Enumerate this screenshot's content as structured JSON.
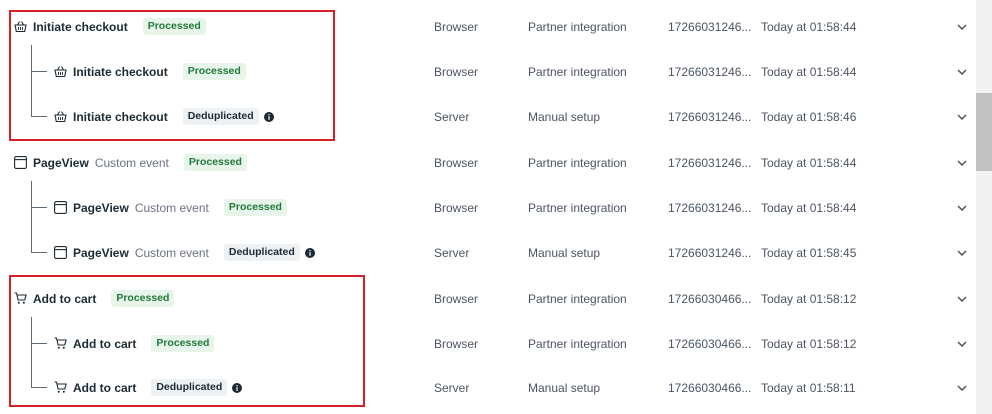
{
  "rows": [
    {
      "icon": "basket-icon",
      "name": "Initiate checkout",
      "custom": "",
      "status": "Processed",
      "source": "Browser",
      "method": "Partner integration",
      "id": "17266031246...",
      "time": "Today at 01:58:44"
    },
    {
      "icon": "basket-icon",
      "name": "Initiate checkout",
      "custom": "",
      "status": "Processed",
      "source": "Browser",
      "method": "Partner integration",
      "id": "17266031246...",
      "time": "Today at 01:58:44"
    },
    {
      "icon": "basket-icon",
      "name": "Initiate checkout",
      "custom": "",
      "status": "Deduplicated",
      "source": "Server",
      "method": "Manual setup",
      "id": "17266031246...",
      "time": "Today at 01:58:46"
    },
    {
      "icon": "browser-window-icon",
      "name": "PageView",
      "custom": "Custom event",
      "status": "Processed",
      "source": "Browser",
      "method": "Partner integration",
      "id": "17266031246...",
      "time": "Today at 01:58:44"
    },
    {
      "icon": "browser-window-icon",
      "name": "PageView",
      "custom": "Custom event",
      "status": "Processed",
      "source": "Browser",
      "method": "Partner integration",
      "id": "17266031246...",
      "time": "Today at 01:58:44"
    },
    {
      "icon": "browser-window-icon",
      "name": "PageView",
      "custom": "Custom event",
      "status": "Deduplicated",
      "source": "Server",
      "method": "Manual setup",
      "id": "17266031246...",
      "time": "Today at 01:58:45"
    },
    {
      "icon": "cart-icon",
      "name": "Add to cart",
      "custom": "",
      "status": "Processed",
      "source": "Browser",
      "method": "Partner integration",
      "id": "17266030466...",
      "time": "Today at 01:58:12"
    },
    {
      "icon": "cart-icon",
      "name": "Add to cart",
      "custom": "",
      "status": "Processed",
      "source": "Browser",
      "method": "Partner integration",
      "id": "17266030466...",
      "time": "Today at 01:58:12"
    },
    {
      "icon": "cart-icon",
      "name": "Add to cart",
      "custom": "",
      "status": "Deduplicated",
      "source": "Server",
      "method": "Manual setup",
      "id": "17266030466...",
      "time": "Today at 01:58:11"
    }
  ],
  "colors": {
    "processed_bg": "#e8f5ea",
    "processed_text": "#1f7a3a",
    "dedup_bg": "#eef1f4",
    "highlight": "#d61f26"
  }
}
